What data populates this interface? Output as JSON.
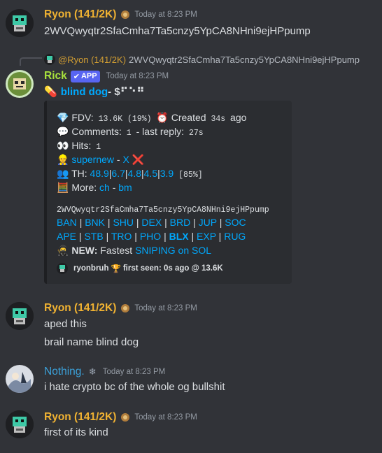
{
  "messages": [
    {
      "author": "Ryon (141/2K)",
      "time": "Today at 8:23 PM",
      "text": "2WVQwyqtr2SfaCmha7Ta5cnzy5YpCA8NHni9ejHPpump",
      "color": "#f0b232"
    },
    {
      "reply_author": "@Ryon (141/2K)",
      "reply_text": "2WVQwyqtr2SfaCmha7Ta5cnzy5YpCA8NHni9ejHPpump",
      "author": "Rick",
      "app_tag": "APP",
      "time": "Today at 8:23 PM",
      "title_prefix": "💊",
      "title_link": "blind dog",
      "title_suffix": " - $⠋⠑⠛",
      "color": "#a9e23c"
    },
    {
      "author": "Ryon (141/2K)",
      "time": "Today at 8:23 PM",
      "lines": [
        "aped this",
        "brail name blind dog"
      ],
      "color": "#f0b232"
    },
    {
      "author": "Nothing.",
      "time": "Today at 8:23 PM",
      "text": "i hate crypto bc of the whole og bullshit",
      "color": "#3ba0d8"
    },
    {
      "author": "Ryon (141/2K)",
      "time": "Today at 8:23 PM",
      "text": "first of its kind",
      "color": "#f0b232"
    }
  ],
  "embed": {
    "fdv_label": "FDV:",
    "fdv_value": "13.6K (19%)",
    "created_label": "Created",
    "created_value": "34s",
    "created_suffix": "ago",
    "comments_label": "Comments:",
    "comments_value": "1",
    "last_reply_label": "- last reply:",
    "last_reply_value": "27s",
    "hits_label": "Hits:",
    "hits_value": "1",
    "dev_name": "supernew",
    "dev_x": "X",
    "th_label": "TH:",
    "th_values": [
      "48.9",
      "6.7",
      "4.8",
      "4.5",
      "3.9"
    ],
    "th_total": "[85%]",
    "more_label": "More:",
    "more_links": [
      "ch",
      "bm"
    ],
    "ca": "2WVQwyqtr2SfaCmha7Ta5cnzy5YpCA8NHni9ejHPpump",
    "links_row1": [
      "BAN",
      "BNK",
      "SHU",
      "DEX",
      "BRD",
      "JUP",
      "SOC"
    ],
    "links_row2": [
      "APE",
      "STB",
      "TRO",
      "PHO",
      "BLX",
      "EXP",
      "RUG"
    ],
    "new_label": "NEW:",
    "new_text": "Fastest",
    "new_link": "SNIPING on SOL",
    "footer_user": "ryonbruh",
    "footer_text": "first seen: 0s ago @ 13.6K"
  }
}
